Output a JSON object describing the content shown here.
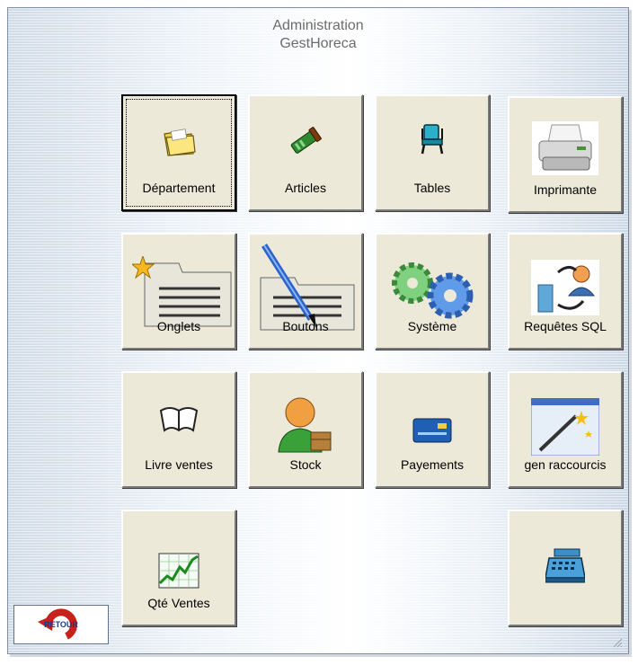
{
  "window": {
    "title_line1": "Administration",
    "title_line2": "GestHoreca"
  },
  "tiles": [
    {
      "label": "Département",
      "icon": "folder-icon"
    },
    {
      "label": "Articles",
      "icon": "articles-icon"
    },
    {
      "label": "Tables",
      "icon": "chair-icon"
    },
    {
      "label": "Imprimante",
      "icon": "printer-icon"
    },
    {
      "label": "Onglets",
      "icon": "tabs-document-icon"
    },
    {
      "label": "Boutons",
      "icon": "pen-document-icon"
    },
    {
      "label": "Système",
      "icon": "gears-icon"
    },
    {
      "label": "Requêtes SQL",
      "icon": "database-user-icon"
    },
    {
      "label": "Livre ventes",
      "icon": "open-book-icon"
    },
    {
      "label": "Stock",
      "icon": "user-box-icon"
    },
    {
      "label": "Payements",
      "icon": "credit-card-icon"
    },
    {
      "label": "gen raccourcis",
      "icon": "magic-wand-icon"
    },
    {
      "label": "Qté Ventes",
      "icon": "sales-chart-icon"
    },
    {
      "label": "",
      "icon": "cash-register-icon"
    }
  ],
  "retour": {
    "label": "RETOUR",
    "icon": "retour-arrow-icon"
  },
  "colors": {
    "tile_face": "#ece9d8",
    "title_text": "#6c6c6c"
  }
}
